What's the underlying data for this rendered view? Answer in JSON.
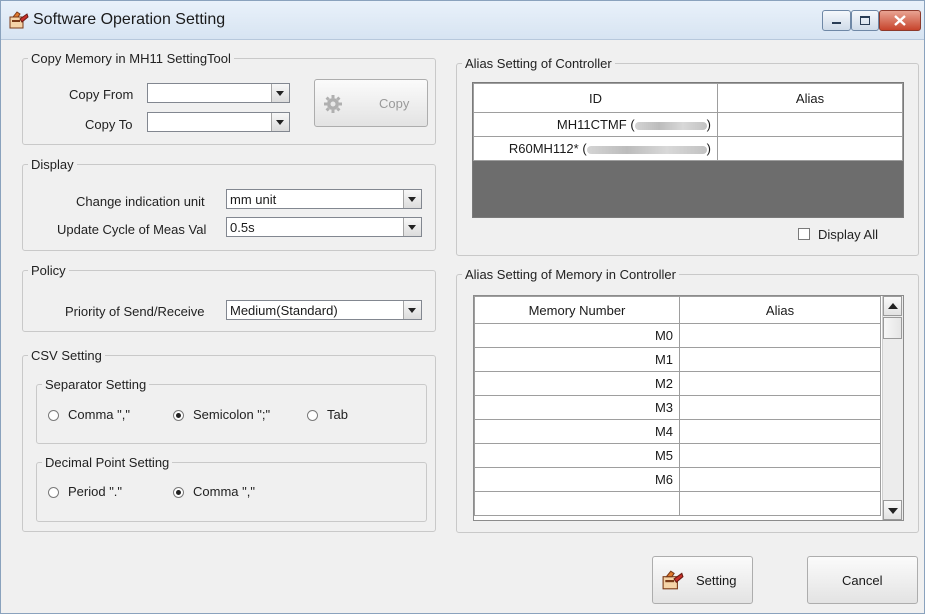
{
  "window": {
    "title": "Software Operation Setting"
  },
  "copy_memory": {
    "legend": "Copy Memory in MH11 SettingTool",
    "copy_from_label": "Copy From",
    "copy_to_label": "Copy To",
    "copy_from_value": "",
    "copy_to_value": "",
    "copy_button": "Copy"
  },
  "display": {
    "legend": "Display",
    "unit_label": "Change indication unit",
    "unit_value": "mm unit",
    "cycle_label": "Update Cycle of Meas Val",
    "cycle_value": "0.5s"
  },
  "policy": {
    "legend": "Policy",
    "priority_label": "Priority of Send/Receive",
    "priority_value": "Medium(Standard)"
  },
  "csv": {
    "legend": "CSV Setting",
    "separator": {
      "legend": "Separator Setting",
      "options": [
        "Comma \",\"",
        "Semicolon \";\"",
        "Tab"
      ],
      "selected": "Semicolon \";\""
    },
    "decimal": {
      "legend": "Decimal Point Setting",
      "options": [
        "Period \".\"",
        "Comma \",\""
      ],
      "selected": "Comma \",\""
    }
  },
  "alias_controller": {
    "legend": "Alias Setting of Controller",
    "columns": [
      "ID",
      "Alias"
    ],
    "rows": [
      {
        "id_prefix": "MH11CTMF (",
        "id_suffix": ")",
        "alias": ""
      },
      {
        "id_prefix": "R60MH112* (",
        "id_suffix": ")",
        "alias": ""
      }
    ],
    "display_all_label": "Display All",
    "display_all_checked": false
  },
  "alias_memory": {
    "legend": "Alias Setting of Memory in Controller",
    "columns": [
      "Memory Number",
      "Alias"
    ],
    "rows": [
      "M0",
      "M1",
      "M2",
      "M3",
      "M4",
      "M5",
      "M6"
    ]
  },
  "footer": {
    "setting_button": "Setting",
    "cancel_button": "Cancel"
  },
  "icons": {
    "app": "settings-hand-icon",
    "copy": "gear-icon",
    "setting": "settings-hand-icon"
  }
}
